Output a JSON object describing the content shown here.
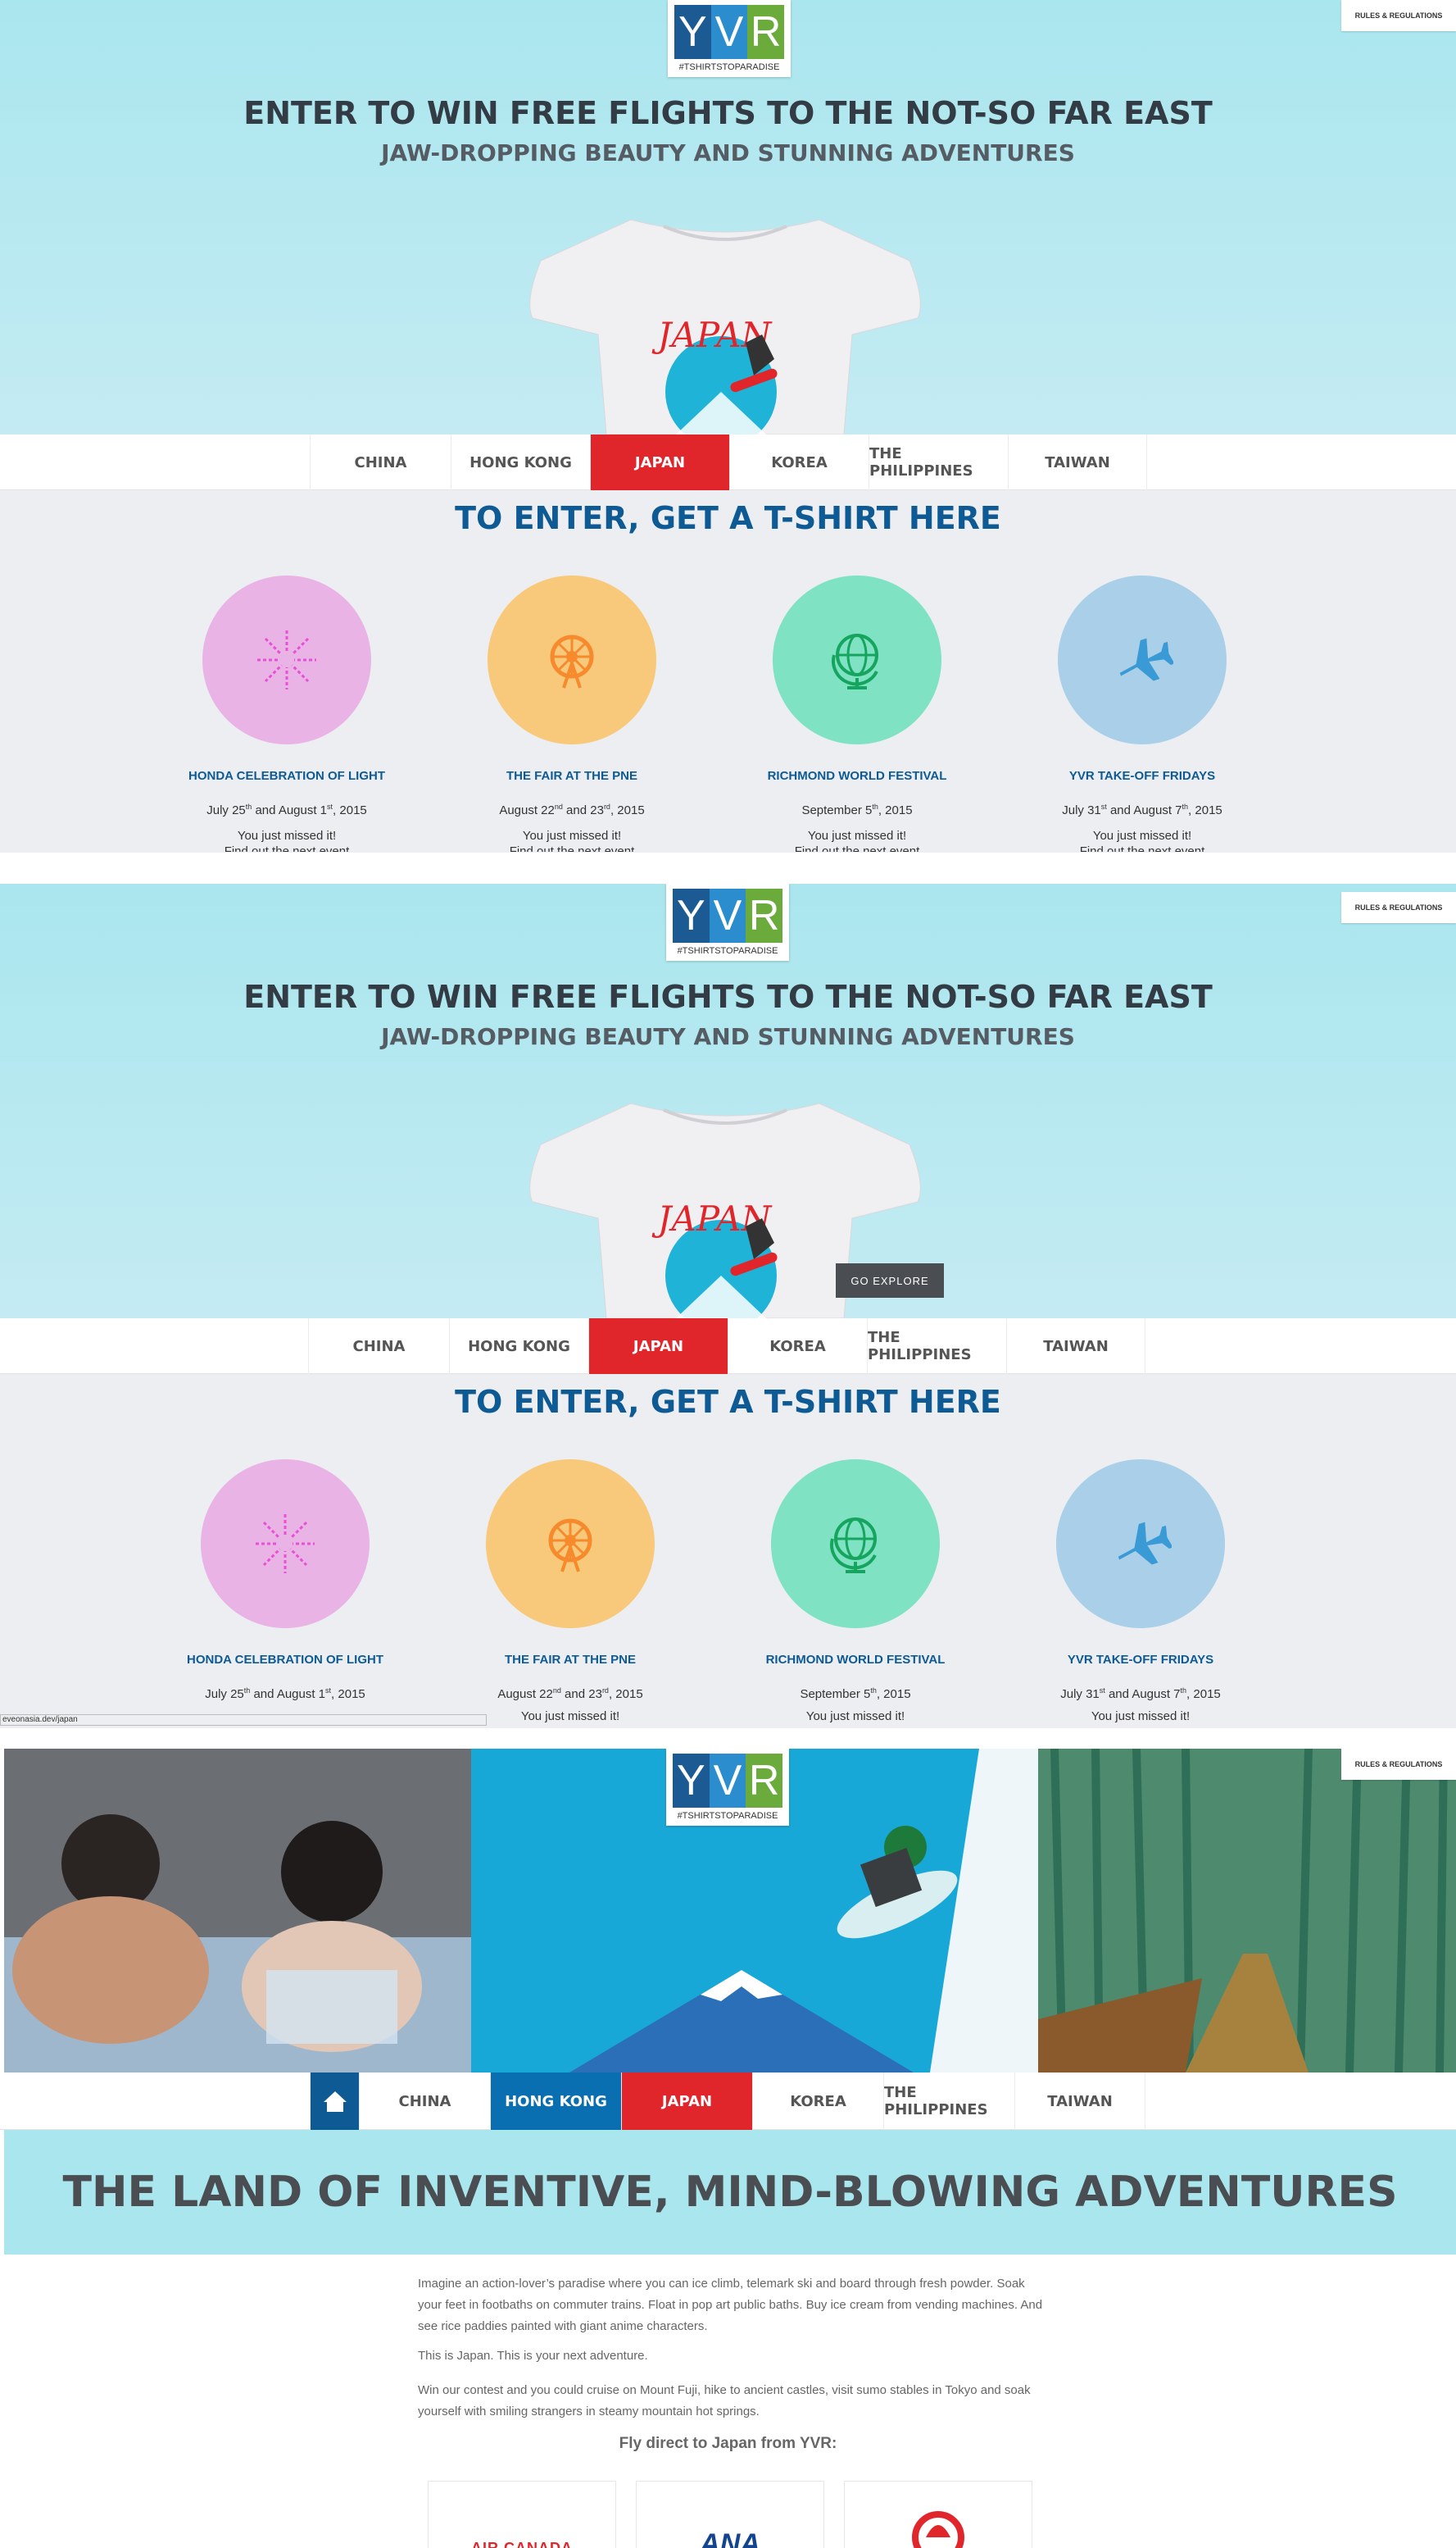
{
  "logo": {
    "letters": [
      "Y",
      "V",
      "R"
    ],
    "tagline": "#TSHIRTSTOPARADISE"
  },
  "rules_link": "RULES & REGULATIONS",
  "hero": {
    "title": "ENTER TO WIN FREE FLIGHTS TO THE NOT-SO FAR EAST",
    "subtitle": "JAW-DROPPING BEAUTY AND STUNNING ADVENTURES",
    "shirt_text": "JAPAN",
    "explore_button": "GO EXPLORE"
  },
  "nav": {
    "tabs": [
      "CHINA",
      "HONG KONG",
      "JAPAN",
      "KOREA",
      "THE PHILIPPINES",
      "TAIWAN"
    ],
    "active": "JAPAN",
    "hover": "HONG KONG"
  },
  "enter": {
    "title": "TO ENTER, GET A T-SHIRT HERE",
    "events": [
      {
        "name": "HONDA CELEBRATION OF LIGHT",
        "date_a": "July 25",
        "sup_a": "th",
        "date_mid": " and August 1",
        "sup_b": "st",
        "date_end": ", 2015",
        "status": "You just missed it!",
        "status2": "Find out the next event",
        "color": "#e9b3e6",
        "icon": "fireworks-icon",
        "icon_color": "#e94fd6"
      },
      {
        "name": "THE FAIR AT THE PNE",
        "date_a": "August 22",
        "sup_a": "nd",
        "date_mid": " and 23",
        "sup_b": "rd",
        "date_end": ", 2015",
        "status": "You just missed it!",
        "status2": "Find out the next event",
        "color": "#f8c97a",
        "icon": "ferris-wheel-icon",
        "icon_color": "#f78a2c"
      },
      {
        "name": "RICHMOND WORLD FESTIVAL",
        "date_a": "September 5",
        "sup_a": "th",
        "date_mid": ", 2015",
        "sup_b": "",
        "date_end": "",
        "status": "You just missed it!",
        "status2": "Find out the next event",
        "color": "#7fe2c3",
        "icon": "globe-icon",
        "icon_color": "#16a55e"
      },
      {
        "name": "YVR TAKE-OFF FRIDAYS",
        "date_a": "July 31",
        "sup_a": "st",
        "date_mid": " and August 7",
        "sup_b": "th",
        "date_end": ", 2015",
        "status": "You just missed it!",
        "status2": "Find out the next event",
        "color": "#a9d0e8",
        "icon": "airplane-icon",
        "icon_color": "#3a9ad6"
      }
    ]
  },
  "status_bar": "eveonasia.dev/japan",
  "japan_page": {
    "banner_title": "THE LAND OF INVENTIVE, MIND-BLOWING ADVENTURES",
    "paragraphs": [
      "Imagine an action-lover’s paradise where you can ice climb, telemark ski and board through fresh powder. Soak your feet in footbaths on commuter trains. Float in pop art public baths. Buy ice cream from vending machines. And see rice paddies painted with giant anime characters.",
      "This is Japan. This is your next adventure.",
      "Win our contest and you could cruise on Mount Fuji, hike to ancient castles, visit sumo stables in Tokyo and soak yourself with smiling strangers in steamy mountain hot springs."
    ],
    "fly_direct": "Fly direct to Japan from YVR:",
    "airlines": [
      "AIR CANADA",
      "ANA",
      "JAL"
    ]
  },
  "colors": {
    "hero_bg": "#aae6ee",
    "nav_active": "#e1262b",
    "nav_hover": "#0a6fb0",
    "brand_blue": "#0d5a94",
    "gray_bg": "#eceef1"
  }
}
